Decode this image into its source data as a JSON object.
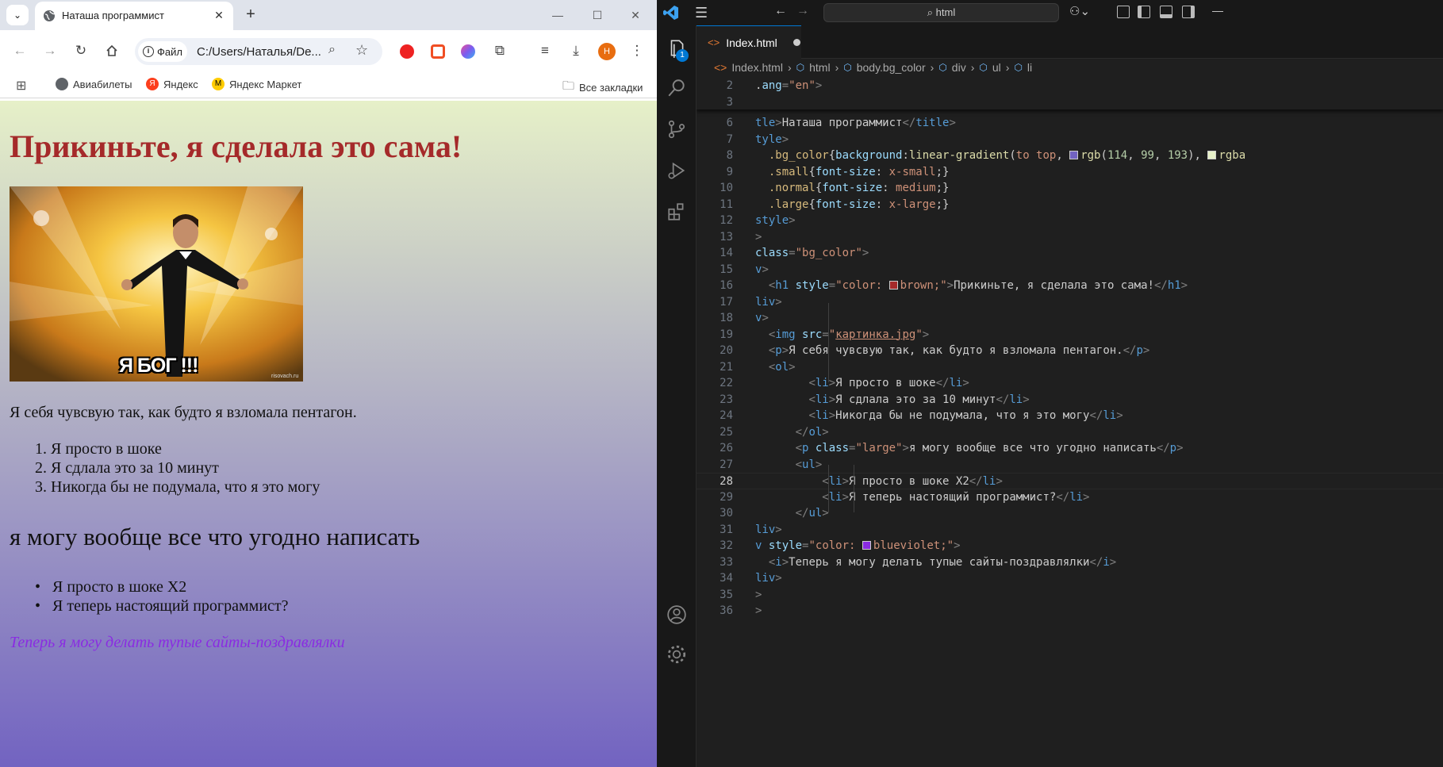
{
  "browser": {
    "tab_title": "Наташа программист",
    "site_label": "Файл",
    "url": "C:/Users/Наталья/De...",
    "avatar_letter": "Н",
    "bookmarks": [
      "Авиабилеты",
      "Яндекс",
      "Яндекс Маркет"
    ],
    "all_bookmarks": "Все закладки"
  },
  "page": {
    "heading": "Прикиньте, я сделала это сама!",
    "image_caption": "Я БОГ !!!",
    "image_watermark": "risovach.ru",
    "paragraph": "Я себя чувсвую так, как будто я взломала пентагон.",
    "ordered_list": [
      "Я просто в шоке",
      "Я сдлала это за 10 минут",
      "Никогда бы не подумала, что я это могу"
    ],
    "large_paragraph": "я могу вообще все что угодно написать",
    "unordered_list": [
      "Я просто в шоке Х2",
      "Я теперь настоящий программист?"
    ],
    "italic_text": "Теперь я могу делать тупые сайты-поздравлялки",
    "colors": {
      "heading": "brown",
      "italic": "blueviolet"
    }
  },
  "vscode": {
    "search_text": "html",
    "badge_count": "1",
    "tab_label": "Index.html",
    "breadcrumb": [
      "Index.html",
      "html",
      "body.bg_color",
      "div",
      "ul",
      "li"
    ],
    "lines": [
      {
        "n": "2",
        "html": ".<span class='a'>ang</span><span class='p'>=</span><span class='s'>\"en\"</span><span class='p'>&gt;</span>"
      },
      {
        "n": "3",
        "html": ""
      },
      {
        "n": "6",
        "html": "<span class='t'>tle</span><span class='p'>&gt;</span>Наташа программист<span class='p'>&lt;/</span><span class='t'>title</span><span class='p'>&gt;</span>"
      },
      {
        "n": "7",
        "html": "<span class='t'>tyle</span><span class='p'>&gt;</span>"
      },
      {
        "n": "8",
        "html": "  <span class='sel'>.bg_color</span>{<span class='a'>background</span>:<span class='f'>linear-gradient</span>(<span class='v'>to top</span>, <span class='sw' style='background:rgb(114,99,193)'></span><span class='f'>rgb</span>(<span class='n'>114</span>, <span class='n'>99</span>, <span class='n'>193</span>), <span class='sw' style='background:rgba(230,240,200,1)'></span><span class='f'>rgba</span>"
      },
      {
        "n": "9",
        "html": "  <span class='sel'>.small</span>{<span class='a'>font-size</span>: <span class='v'>x-small</span>;}"
      },
      {
        "n": "10",
        "html": "  <span class='sel'>.normal</span>{<span class='a'>font-size</span>: <span class='v'>medium</span>;}"
      },
      {
        "n": "11",
        "html": "  <span class='sel'>.large</span>{<span class='a'>font-size</span>: <span class='v'>x-large</span>;}"
      },
      {
        "n": "12",
        "html": "<span class='t'>style</span><span class='p'>&gt;</span>"
      },
      {
        "n": "13",
        "html": "<span class='p'>&gt;</span>"
      },
      {
        "n": "14",
        "html": "<span class='a'>class</span><span class='p'>=</span><span class='s'>\"bg_color\"</span><span class='p'>&gt;</span>"
      },
      {
        "n": "15",
        "html": "<span class='t'>v</span><span class='p'>&gt;</span>"
      },
      {
        "n": "16",
        "html": "  <span class='p'>&lt;</span><span class='t'>h1</span> <span class='a'>style</span><span class='p'>=</span><span class='s'>\"color: <span class='sw' style='background:brown'></span>brown;\"</span><span class='p'>&gt;</span>Прикиньте, я сделала это сама!<span class='p'>&lt;/</span><span class='t'>h1</span><span class='p'>&gt;</span>"
      },
      {
        "n": "17",
        "html": "<span class='t'>liv</span><span class='p'>&gt;</span>"
      },
      {
        "n": "18",
        "html": "<span class='t'>v</span><span class='p'>&gt;</span>"
      },
      {
        "n": "19",
        "html": "  <span class='p'>&lt;</span><span class='t'>img</span> <span class='a'>src</span><span class='p'>=</span><span class='s'>\"<u>картинка.jpg</u>\"</span><span class='p'>&gt;</span>"
      },
      {
        "n": "20",
        "html": "  <span class='p'>&lt;</span><span class='t'>p</span><span class='p'>&gt;</span>Я себя чувсвую так, как будто я взломала пентагон.<span class='p'>&lt;/</span><span class='t'>p</span><span class='p'>&gt;</span>"
      },
      {
        "n": "21",
        "html": "  <span class='p'>&lt;</span><span class='t'>ol</span><span class='p'>&gt;</span>"
      },
      {
        "n": "22",
        "html": "        <span class='p'>&lt;</span><span class='t'>li</span><span class='p'>&gt;</span>Я просто в шоке<span class='p'>&lt;/</span><span class='t'>li</span><span class='p'>&gt;</span>"
      },
      {
        "n": "23",
        "html": "        <span class='p'>&lt;</span><span class='t'>li</span><span class='p'>&gt;</span>Я сдлала это за 10 минут<span class='p'>&lt;/</span><span class='t'>li</span><span class='p'>&gt;</span>"
      },
      {
        "n": "24",
        "html": "        <span class='p'>&lt;</span><span class='t'>li</span><span class='p'>&gt;</span>Никогда бы не подумала, что я это могу<span class='p'>&lt;/</span><span class='t'>li</span><span class='p'>&gt;</span>"
      },
      {
        "n": "25",
        "html": "      <span class='p'>&lt;/</span><span class='t'>ol</span><span class='p'>&gt;</span>"
      },
      {
        "n": "26",
        "html": "      <span class='p'>&lt;</span><span class='t'>p</span> <span class='a'>class</span><span class='p'>=</span><span class='s'>\"large\"</span><span class='p'>&gt;</span>я могу вообще все что угодно написать<span class='p'>&lt;/</span><span class='t'>p</span><span class='p'>&gt;</span>"
      },
      {
        "n": "27",
        "html": "      <span class='p'>&lt;</span><span class='t'>ul</span><span class='p'>&gt;</span>"
      },
      {
        "n": "28",
        "html": "          <span class='p'>&lt;</span><span class='t'>li</span><span class='p'>&gt;</span>Я просто в шоке Х2<span class='p'>&lt;/</span><span class='t'>li</span><span class='p'>&gt;</span>"
      },
      {
        "n": "29",
        "html": "          <span class='p'>&lt;</span><span class='t'>li</span><span class='p'>&gt;</span>Я теперь настоящий программист?<span class='p'>&lt;/</span><span class='t'>li</span><span class='p'>&gt;</span>"
      },
      {
        "n": "30",
        "html": "      <span class='p'>&lt;/</span><span class='t'>ul</span><span class='p'>&gt;</span>"
      },
      {
        "n": "31",
        "html": "<span class='t'>liv</span><span class='p'>&gt;</span>"
      },
      {
        "n": "32",
        "html": "<span class='t'>v</span> <span class='a'>style</span><span class='p'>=</span><span class='s'>\"color: <span class='sw' style='background:blueviolet'></span>blueviolet;\"</span><span class='p'>&gt;</span>"
      },
      {
        "n": "33",
        "html": "  <span class='p'>&lt;</span><span class='t'>i</span><span class='p'>&gt;</span>Теперь я могу делать тупые сайты-поздравлялки<span class='p'>&lt;/</span><span class='t'>i</span><span class='p'>&gt;</span>"
      },
      {
        "n": "34",
        "html": "<span class='t'>liv</span><span class='p'>&gt;</span>"
      },
      {
        "n": "35",
        "html": "<span class='p'>&gt;</span>"
      },
      {
        "n": "36",
        "html": "<span class='p'>&gt;</span>"
      }
    ],
    "current_line": "28",
    "colors": {
      "accent": "#0078d4",
      "background": "#1f1f1f"
    }
  }
}
